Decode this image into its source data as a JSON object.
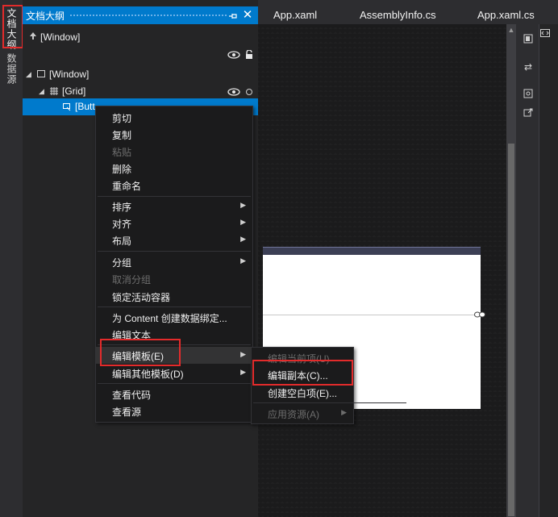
{
  "left_strip": {
    "outline_tab": "文档大纲",
    "datasource_tab": "数据源"
  },
  "outline": {
    "title": "文档大纲",
    "pin_icon": "pin-icon",
    "close_icon": "close-icon",
    "scope": "[Window]",
    "tree": [
      {
        "label": "[Window]",
        "level": 0
      },
      {
        "label": "[Grid]",
        "level": 1
      },
      {
        "label": "[Butt",
        "level": 2,
        "selected": true
      }
    ]
  },
  "tabs": [
    "App.xaml",
    "AssemblyInfo.cs",
    "App.xaml.cs"
  ],
  "context_menu": {
    "items": [
      {
        "label": "剪切",
        "enabled": true
      },
      {
        "label": "复制",
        "enabled": true
      },
      {
        "label": "粘贴",
        "enabled": false
      },
      {
        "label": "删除",
        "enabled": true
      },
      {
        "label": "重命名",
        "enabled": true
      },
      {
        "label": "排序",
        "enabled": true,
        "submenu": true
      },
      {
        "label": "对齐",
        "enabled": true,
        "submenu": true
      },
      {
        "label": "布局",
        "enabled": true,
        "submenu": true
      },
      {
        "label": "分组",
        "enabled": true,
        "submenu": true
      },
      {
        "label": "取消分组",
        "enabled": false
      },
      {
        "label": "锁定活动容器",
        "enabled": true
      },
      {
        "label": "为 Content 创建数据绑定...",
        "enabled": true
      },
      {
        "label": "编辑文本",
        "enabled": true
      },
      {
        "label": "编辑模板(E)",
        "enabled": true,
        "submenu": true,
        "highlighted": true
      },
      {
        "label": "编辑其他模板(D)",
        "enabled": true,
        "submenu": true
      },
      {
        "label": "查看代码",
        "enabled": true
      },
      {
        "label": "查看源",
        "enabled": true
      }
    ]
  },
  "submenu": {
    "items": [
      {
        "label": "编辑当前项(U)",
        "enabled": false
      },
      {
        "label": "编辑副本(C)...",
        "enabled": true
      },
      {
        "label": "创建空白项(E)...",
        "enabled": true
      },
      {
        "label": "应用资源(A)",
        "enabled": false,
        "submenu": true
      }
    ]
  },
  "colors": {
    "accent": "#007acc",
    "highlight_box": "#e32b2b",
    "menu_bg": "#1b1b1c"
  }
}
